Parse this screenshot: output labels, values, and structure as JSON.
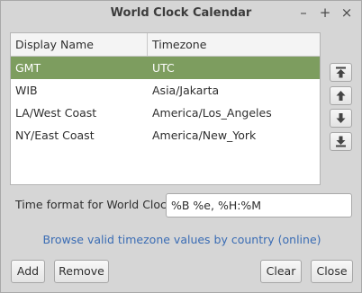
{
  "window": {
    "title": "World Clock Calendar",
    "controls": {
      "minimize": "–",
      "maximize": "+",
      "close": "×"
    }
  },
  "table": {
    "columns": [
      "Display Name",
      "Timezone"
    ],
    "rows": [
      {
        "name": "GMT",
        "timezone": "UTC",
        "selected": true
      },
      {
        "name": "WIB",
        "timezone": "Asia/Jakarta",
        "selected": false
      },
      {
        "name": "LA/West Coast",
        "timezone": "America/Los_Angeles",
        "selected": false
      },
      {
        "name": "NY/East Coast",
        "timezone": "America/New_York",
        "selected": false
      }
    ]
  },
  "side_buttons": {
    "move_top": "move-to-top-icon",
    "move_up": "arrow-up-icon",
    "move_down": "arrow-down-icon",
    "move_bottom": "move-to-bottom-icon"
  },
  "format": {
    "label": "Time format for World Clocks",
    "value": "%B %e, %H:%M"
  },
  "link_text": "Browse valid timezone values by country (online)",
  "buttons": {
    "add": "Add",
    "remove": "Remove",
    "clear": "Clear",
    "close": "Close"
  },
  "colors": {
    "selection": "#7d9d5f",
    "link": "#3a6cb4"
  }
}
